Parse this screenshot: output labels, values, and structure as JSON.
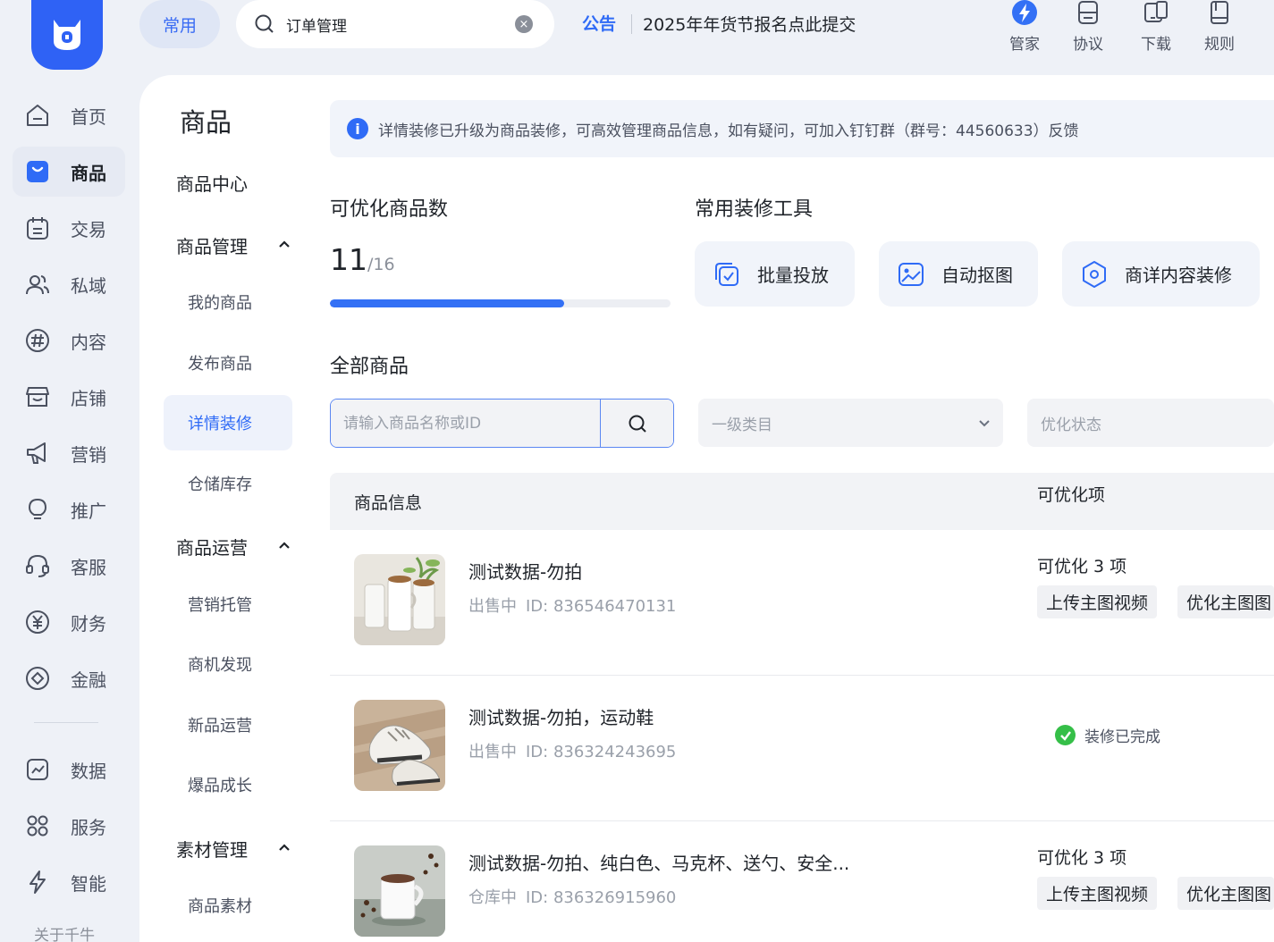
{
  "topbar": {
    "common_label": "常用",
    "search_value": "订单管理",
    "notice_tag": "公告",
    "notice_text": "2025年年货节报名点此提交",
    "tools": [
      {
        "label": "管家",
        "icon": "lightning-badge-icon"
      },
      {
        "label": "协议",
        "icon": "document-icon"
      },
      {
        "label": "下载",
        "icon": "device-icon"
      },
      {
        "label": "规则",
        "icon": "book-icon"
      }
    ]
  },
  "sidebar": {
    "items": [
      {
        "label": "首页",
        "icon": "home-icon"
      },
      {
        "label": "商品",
        "icon": "bag-icon"
      },
      {
        "label": "交易",
        "icon": "calendar-icon"
      },
      {
        "label": "私域",
        "icon": "users-icon"
      },
      {
        "label": "内容",
        "icon": "hashtag-icon"
      },
      {
        "label": "店铺",
        "icon": "store-icon"
      },
      {
        "label": "营销",
        "icon": "megaphone-icon"
      },
      {
        "label": "推广",
        "icon": "bulb-icon"
      },
      {
        "label": "客服",
        "icon": "headset-icon"
      },
      {
        "label": "财务",
        "icon": "yen-icon"
      },
      {
        "label": "金融",
        "icon": "diamond-icon"
      },
      {
        "label": "数据",
        "icon": "chart-icon"
      },
      {
        "label": "服务",
        "icon": "grid-icon"
      },
      {
        "label": "智能",
        "icon": "bolt-icon"
      }
    ],
    "about": "关于千牛"
  },
  "submenu": {
    "title": "商品",
    "center": "商品中心",
    "groups": [
      {
        "label": "商品管理",
        "items": [
          "我的商品",
          "发布商品",
          "详情装修",
          "仓储库存"
        ]
      },
      {
        "label": "商品运营",
        "items": [
          "营销托管",
          "商机发现",
          "新品运营",
          "爆品成长"
        ]
      },
      {
        "label": "素材管理",
        "items": [
          "商品素材"
        ]
      }
    ]
  },
  "banner": {
    "text": "详情装修已升级为商品装修，可高效管理商品信息，如有疑问，可加入钉钉群（群号：44560633）反馈"
  },
  "stats": {
    "title": "可优化商品数",
    "count": "11",
    "total": "/16",
    "progress_fraction": 0.6875
  },
  "tools_section": {
    "title": "常用装修工具",
    "cards": [
      {
        "label": "批量投放",
        "icon": "batch-deliver-icon"
      },
      {
        "label": "自动抠图",
        "icon": "image-cutout-icon"
      },
      {
        "label": "商详内容装修",
        "icon": "hexagon-settings-icon"
      }
    ]
  },
  "products": {
    "title": "全部商品",
    "search_placeholder": "请输入商品名称或ID",
    "category_placeholder": "一级类目",
    "status_placeholder": "优化状态",
    "col_info": "商品信息",
    "col_opt": "可优化项",
    "rows": [
      {
        "name": "测试数据-勿拍",
        "status": "出售中",
        "id": "ID: 836546470131",
        "opt_title": "可优化 3 项",
        "tags": [
          "上传主图视频",
          "优化主图图"
        ],
        "done": ""
      },
      {
        "name": "测试数据-勿拍，运动鞋",
        "status": "出售中",
        "id": "ID: 836324243695",
        "opt_title": "",
        "tags": [],
        "done": "装修已完成"
      },
      {
        "name": "测试数据-勿拍、纯白色、马克杯、送勺、安全...",
        "status": "仓库中",
        "id": "ID: 836326915960",
        "opt_title": "可优化 3 项",
        "tags": [
          "上传主图视频",
          "优化主图图"
        ],
        "done": ""
      }
    ]
  }
}
